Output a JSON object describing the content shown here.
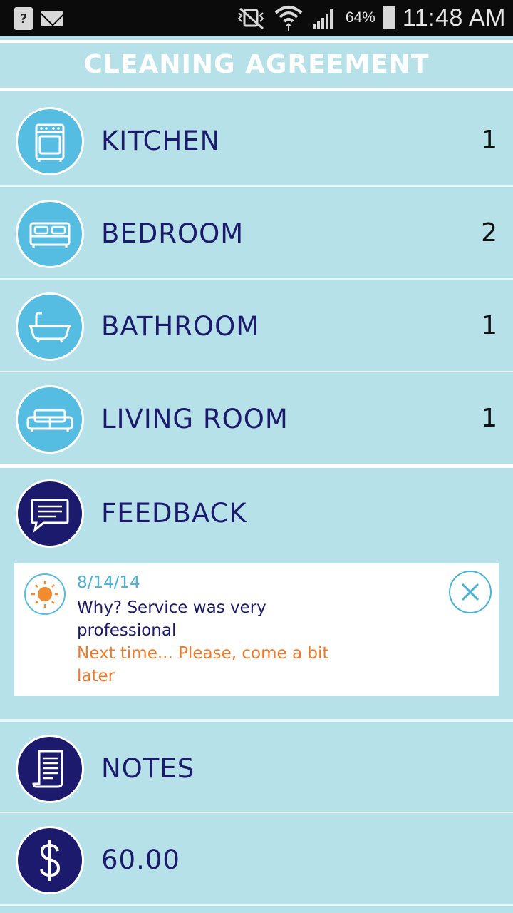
{
  "status_bar": {
    "battery_percent": "64%",
    "time": "11:48 AM"
  },
  "header": {
    "title": "CLEANING AGREEMENT"
  },
  "rooms": [
    {
      "label": "KITCHEN",
      "count": "1",
      "icon": "stove-icon"
    },
    {
      "label": "BEDROOM",
      "count": "2",
      "icon": "bed-icon"
    },
    {
      "label": "BATHROOM",
      "count": "1",
      "icon": "bathtub-icon"
    },
    {
      "label": "LIVING ROOM",
      "count": "1",
      "icon": "sofa-icon"
    }
  ],
  "feedback": {
    "label": "FEEDBACK",
    "icon": "chat-bubble-icon",
    "entry": {
      "date": "8/14/14",
      "why": "Why? Service was very professional",
      "next_time": "Next time... Please, come a bit later"
    }
  },
  "notes": {
    "label": "NOTES",
    "icon": "document-icon"
  },
  "price": {
    "value": "60.00",
    "icon": "dollar-icon"
  },
  "colors": {
    "background": "#b6e1e9",
    "navy": "#1b1a6d",
    "light_blue": "#56bde2",
    "orange": "#ef7a2a"
  }
}
